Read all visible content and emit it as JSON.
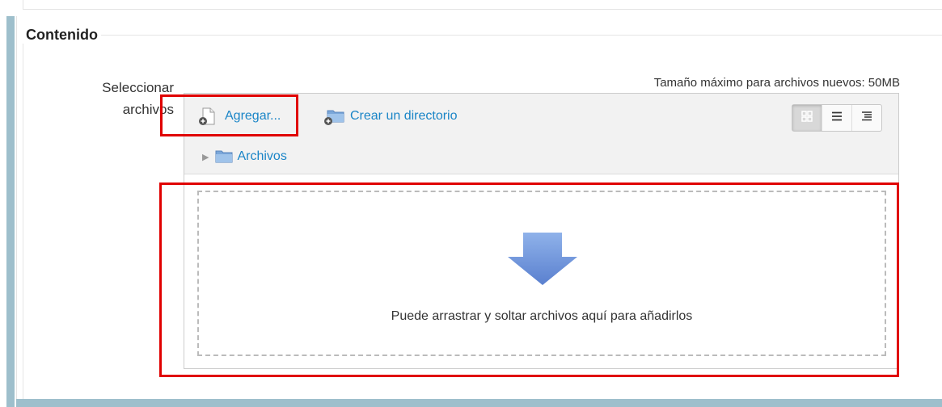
{
  "fieldset": {
    "legend": "Contenido"
  },
  "field": {
    "label": "Seleccionar archivos",
    "max_size": "Tamaño máximo para archivos nuevos: 50MB"
  },
  "toolbar": {
    "add_label": "Agregar...",
    "mkdir_label": "Crear un directorio",
    "views": [
      "view-icons",
      "view-details",
      "view-tree"
    ],
    "active_view": "view-icons"
  },
  "breadcrumb": {
    "folder_label": "Archivos"
  },
  "dropzone": {
    "message": "Puede arrastrar y soltar archivos aquí para añadirlos"
  },
  "colors": {
    "link": "#1a85c7",
    "highlight": "#e00000",
    "side_bar": "#9ebfcc",
    "arrow": "#6b8fd6"
  },
  "icons": [
    "add-file-icon",
    "create-folder-icon",
    "grid-view-icon",
    "list-view-icon",
    "tree-view-icon",
    "expand-triangle-icon",
    "folder-icon",
    "drop-arrow-icon"
  ]
}
